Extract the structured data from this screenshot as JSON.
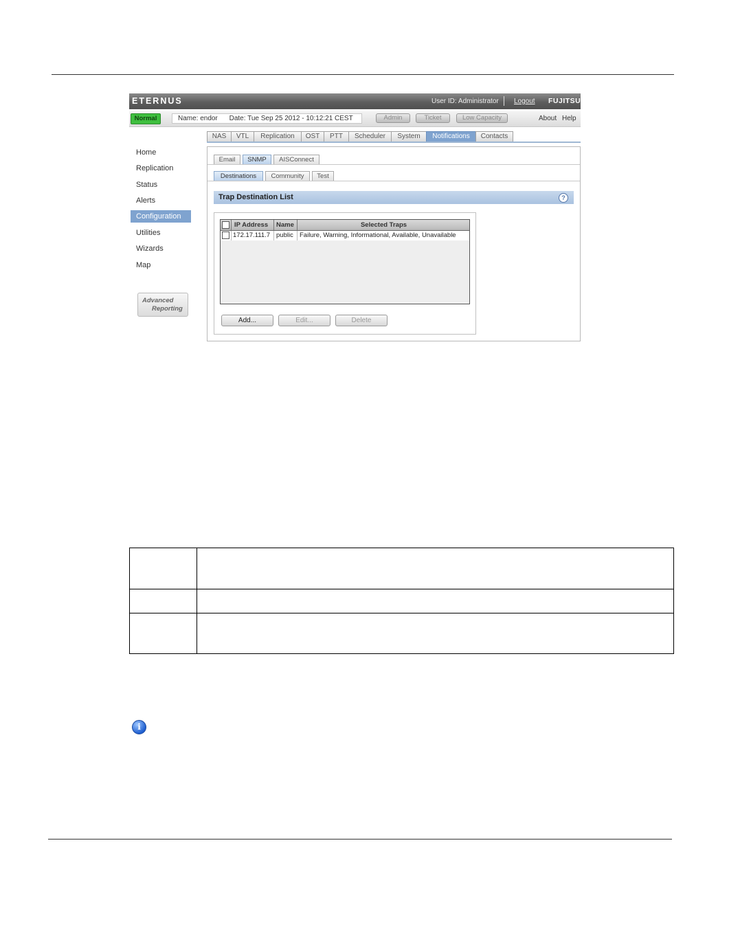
{
  "app": {
    "brand": "ETERNUS",
    "user_id": "User ID: Administrator",
    "logout": "Logout",
    "vendor_logo": "FUJITSU"
  },
  "status": {
    "state": "Normal",
    "name": "Name: endor",
    "date": "Date: Tue Sep 25 2012 - 10:12:21 CEST",
    "buttons": [
      "Admin",
      "Ticket",
      "Low Capacity"
    ],
    "about": "About",
    "help": "Help"
  },
  "main_tabs": [
    "NAS",
    "VTL",
    "Replication",
    "OST",
    "PTT",
    "Scheduler",
    "System",
    "Notifications",
    "Contacts"
  ],
  "active_main_tab": "Notifications",
  "left_nav": {
    "items": [
      "Home",
      "Replication",
      "Status",
      "Alerts",
      "Configuration",
      "Utilities",
      "Wizards",
      "Map"
    ],
    "active": "Configuration",
    "advanced_reporting": [
      "Advanced",
      "Reporting"
    ]
  },
  "notification_tabs": [
    "Email",
    "SNMP",
    "AISConnect"
  ],
  "active_notification_tab": "SNMP",
  "snmp_tabs": [
    "Destinations",
    "Community",
    "Test"
  ],
  "active_snmp_tab": "Destinations",
  "section": {
    "title": "Trap Destination List"
  },
  "table": {
    "headers": [
      "IP Address",
      "Name",
      "Selected Traps"
    ],
    "rows": [
      {
        "ip": "172.17.111.7",
        "name": "public",
        "traps": "Failure, Warning, Informational, Available, Unavailable"
      }
    ]
  },
  "actions": {
    "add": "Add...",
    "edit": "Edit...",
    "delete": "Delete"
  },
  "colors": {
    "accent": "#7fa3cf",
    "status_ok": "#3fbf3f",
    "header_bar": "#5e5e5e"
  },
  "icons": [
    "help-icon",
    "info-icon"
  ]
}
